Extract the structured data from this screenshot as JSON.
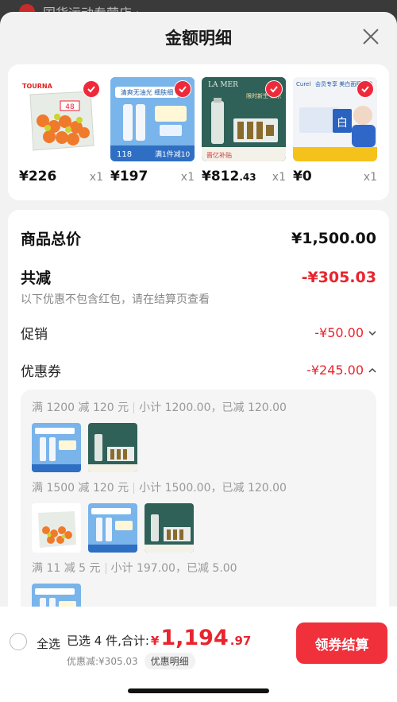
{
  "background_store": {
    "name": "国货运动专营店 ›"
  },
  "sheet": {
    "title": "金额明细"
  },
  "products": [
    {
      "brand": "TOURNA",
      "tag": "48",
      "price": "¥226",
      "price_dec": "",
      "qty": "x1",
      "checked": true
    },
    {
      "brand": "Curel",
      "tag": "清爽无油光 细肤细",
      "tag2": "118",
      "tag3": "满1件减10",
      "price": "¥197",
      "price_dec": "",
      "qty": "x1",
      "checked": true
    },
    {
      "brand": "LA MER",
      "tag": "限时新生·臻乐",
      "tag2": "晋亿补贴",
      "price": "¥812",
      "price_dec": ".43",
      "qty": "x1",
      "checked": true
    },
    {
      "brand": "Curel",
      "tag": "会员专享 美白面膜体验",
      "tag2": "白",
      "price": "¥0",
      "price_dec": "",
      "qty": "x1",
      "checked": true
    }
  ],
  "summary": {
    "goods_total_label": "商品总价",
    "goods_total_value": "¥1,500.00",
    "reduce_label": "共减",
    "reduce_value": "-¥305.03",
    "note": "以下优惠不包含红包，请在结算页查看",
    "promo_label": "促销",
    "promo_value": "-¥50.00",
    "coupon_label": "优惠券",
    "coupon_value": "-¥245.00"
  },
  "coupon_groups": [
    {
      "rule": "满 1200 减 120 元",
      "detail": "小计 1200.00，已减 120.00"
    },
    {
      "rule": "满 1500 减 120 元",
      "detail": "小计 1500.00，已减 120.00"
    },
    {
      "rule": "满 11 减 5 元",
      "detail": "小计 197.00，已减 5.00"
    }
  ],
  "bottom": {
    "select_all": "全选",
    "selected_text": "已选 4 件,合计:",
    "currency": "¥",
    "total_int": "1,194",
    "total_dec": ".97",
    "discount_text": "优惠减:¥305.03",
    "detail_button": "优惠明细",
    "checkout_button": "领券结算"
  },
  "colors": {
    "accent": "#f0303b",
    "price_red": "#e8252f"
  }
}
